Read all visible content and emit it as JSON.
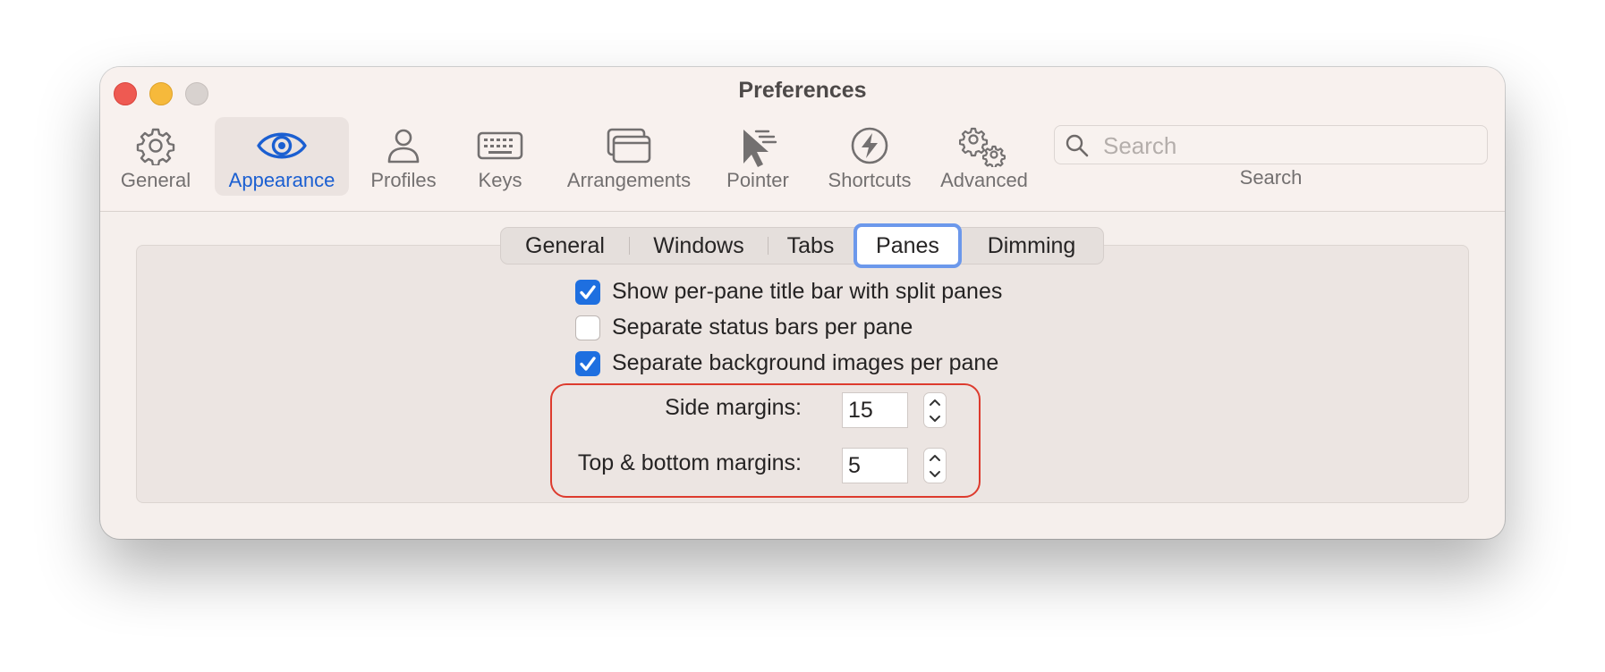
{
  "window": {
    "title": "Preferences"
  },
  "toolbar": {
    "items": [
      {
        "label": "General",
        "icon": "gear-icon",
        "selected": false
      },
      {
        "label": "Appearance",
        "icon": "eye-icon",
        "selected": true
      },
      {
        "label": "Profiles",
        "icon": "person-icon",
        "selected": false
      },
      {
        "label": "Keys",
        "icon": "keyboard-icon",
        "selected": false
      },
      {
        "label": "Arrangements",
        "icon": "windows-icon",
        "selected": false
      },
      {
        "label": "Pointer",
        "icon": "cursor-icon",
        "selected": false
      },
      {
        "label": "Shortcuts",
        "icon": "bolt-icon",
        "selected": false
      },
      {
        "label": "Advanced",
        "icon": "gears-icon",
        "selected": false
      }
    ],
    "search": {
      "placeholder": "Search",
      "caption": "Search"
    }
  },
  "subtabs": {
    "items": [
      "General",
      "Windows",
      "Tabs",
      "Panes",
      "Dimming"
    ],
    "selected": "Panes"
  },
  "options": [
    {
      "label": "Show per-pane title bar with split panes",
      "checked": true
    },
    {
      "label": "Separate status bars per pane",
      "checked": false
    },
    {
      "label": "Separate background images per pane",
      "checked": true
    }
  ],
  "margins": {
    "side_label": "Side margins:",
    "side_value": "15",
    "topbottom_label": "Top & bottom margins:",
    "topbottom_value": "5"
  },
  "colors": {
    "accent": "#1e6fe0",
    "highlight_border": "#dd3b2e",
    "selected_tab_border": "#6c98eb"
  }
}
